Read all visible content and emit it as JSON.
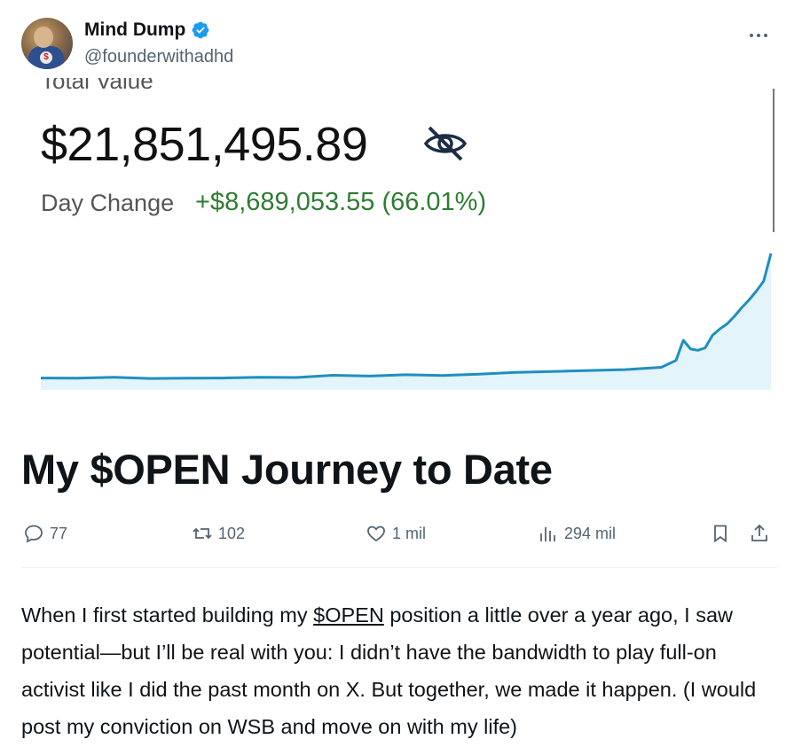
{
  "author": {
    "display_name": "Mind Dump",
    "handle": "@founderwithadhd",
    "avatar_logo": "$"
  },
  "media": {
    "cut_label": "Total Value",
    "total_value": "$21,851,495.89",
    "day_change_label": "Day Change",
    "day_change_value": "+$8,689,053.55 (66.01%)"
  },
  "chart_data": {
    "type": "area",
    "title": "",
    "xlabel": "",
    "ylabel": "",
    "color": "#1f8fbf",
    "fill": "#e3f4fb",
    "x": [
      0,
      5,
      10,
      15,
      20,
      25,
      30,
      35,
      40,
      45,
      50,
      55,
      60,
      65,
      70,
      75,
      80,
      85,
      87,
      88,
      89,
      90,
      91,
      92,
      93,
      94,
      95,
      96,
      97,
      98,
      99,
      100
    ],
    "values": [
      1.0,
      0.9,
      1.6,
      0.6,
      0.9,
      1.0,
      1.6,
      1.4,
      3.2,
      2.5,
      3.6,
      3.0,
      4.0,
      5.5,
      6.2,
      7.0,
      7.7,
      9.5,
      15.0,
      31.0,
      24.0,
      23.0,
      25.0,
      35.0,
      40.0,
      44.0,
      50.0,
      57.0,
      63.0,
      70.0,
      78.0,
      100.0
    ],
    "ylim": [
      0,
      100
    ]
  },
  "title": "My $OPEN Journey to Date",
  "actions": {
    "replies": "77",
    "reposts": "102",
    "likes": "1 mil",
    "views": "294 mil"
  },
  "body": {
    "before": "When I first started building my ",
    "tag": "$OPEN",
    "after": " position a little over a year ago, I saw potential—but I’ll be real with you: I didn’t have the bandwidth to play full-on activist like I did the past month on X. But together, we made it happen. (I would post my conviction on WSB and move on with my life)"
  },
  "colors": {
    "text": "#0f1419",
    "secondary": "#536471",
    "verified": "#1d9bf0",
    "gain": "#2e7d32",
    "chart_line": "#1f8fbf"
  },
  "icons": [
    "verified-badge-icon",
    "more-icon",
    "eye-slash-icon",
    "reply-icon",
    "repost-icon",
    "like-icon",
    "views-icon",
    "bookmark-icon",
    "share-icon"
  ]
}
